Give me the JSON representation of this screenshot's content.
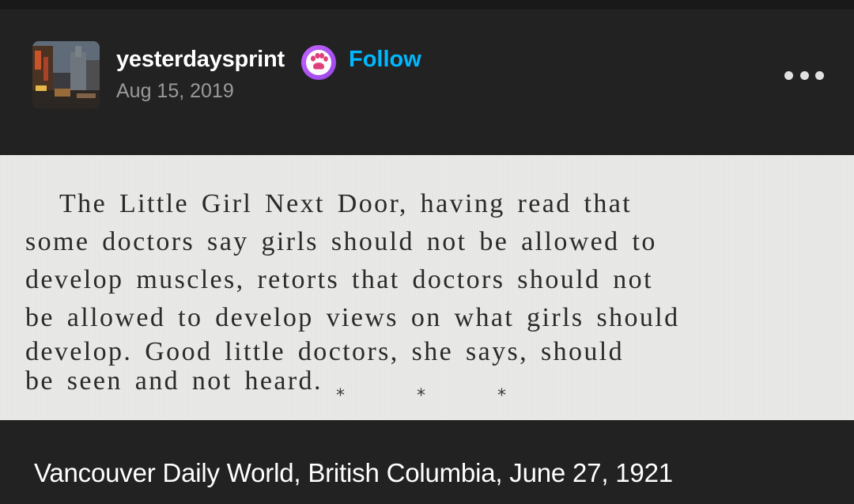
{
  "post": {
    "author": "yesterdaysprint",
    "follow_label": "Follow",
    "date": "Aug 15, 2019",
    "avatar_icon": "city-street-avatar",
    "badge_icon": "paw-badge-icon",
    "more_icon": "more-options-icon"
  },
  "clipping": {
    "lines": [
      "The Little Girl Next Door, having read that",
      "some doctors say girls should not be allowed to",
      "develop muscles, retorts that doctors should not",
      "be allowed to develop views on what girls should",
      "develop. Good little doctors, she says, should",
      "be seen and not heard."
    ],
    "separator": [
      "*",
      "*",
      "*"
    ]
  },
  "caption": "Vancouver Daily World, British Columbia, June 27, 1921",
  "colors": {
    "background": "#222222",
    "follow": "#00b8ff",
    "badge": "#a34ff0",
    "paper": "#e9e9e7"
  }
}
